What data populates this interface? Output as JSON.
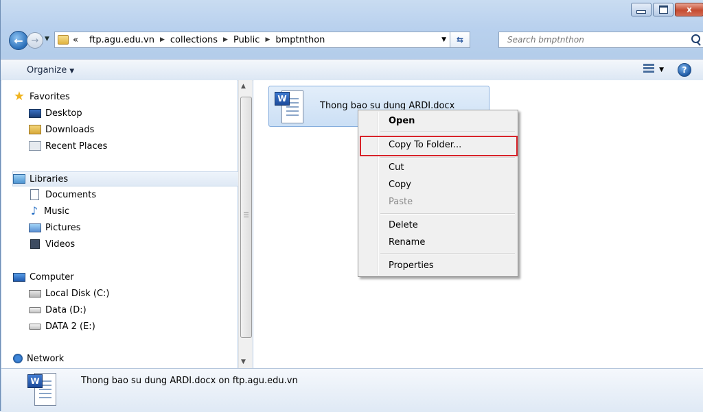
{
  "window": {
    "caption_close_glyph": "x"
  },
  "address_bar": {
    "overflow": "«",
    "crumbs": [
      "ftp.agu.edu.vn",
      "collections",
      "Public",
      "bmptnthon"
    ]
  },
  "search": {
    "placeholder": "Search bmptnthon"
  },
  "toolbar": {
    "organize_label": "Organize",
    "help_glyph": "?"
  },
  "navigation": {
    "favorites": {
      "label": "Favorites",
      "items": [
        "Desktop",
        "Downloads",
        "Recent Places"
      ]
    },
    "libraries": {
      "label": "Libraries",
      "items": [
        "Documents",
        "Music",
        "Pictures",
        "Videos"
      ]
    },
    "computer": {
      "label": "Computer",
      "items": [
        "Local Disk (C:)",
        "Data (D:)",
        "DATA 2 (E:)"
      ]
    },
    "network": {
      "label": "Network"
    }
  },
  "content": {
    "file_name": "Thong bao su dung ARDI.docx",
    "file_badge": "W"
  },
  "context_menu": {
    "items": [
      "Open",
      "Copy To Folder...",
      "Cut",
      "Copy",
      "Paste",
      "Delete",
      "Rename",
      "Properties"
    ],
    "highlight_color": "#d8232a"
  },
  "details_pane": {
    "text": "Thong bao su dung ARDI.docx on ftp.agu.edu.vn",
    "badge": "W"
  }
}
